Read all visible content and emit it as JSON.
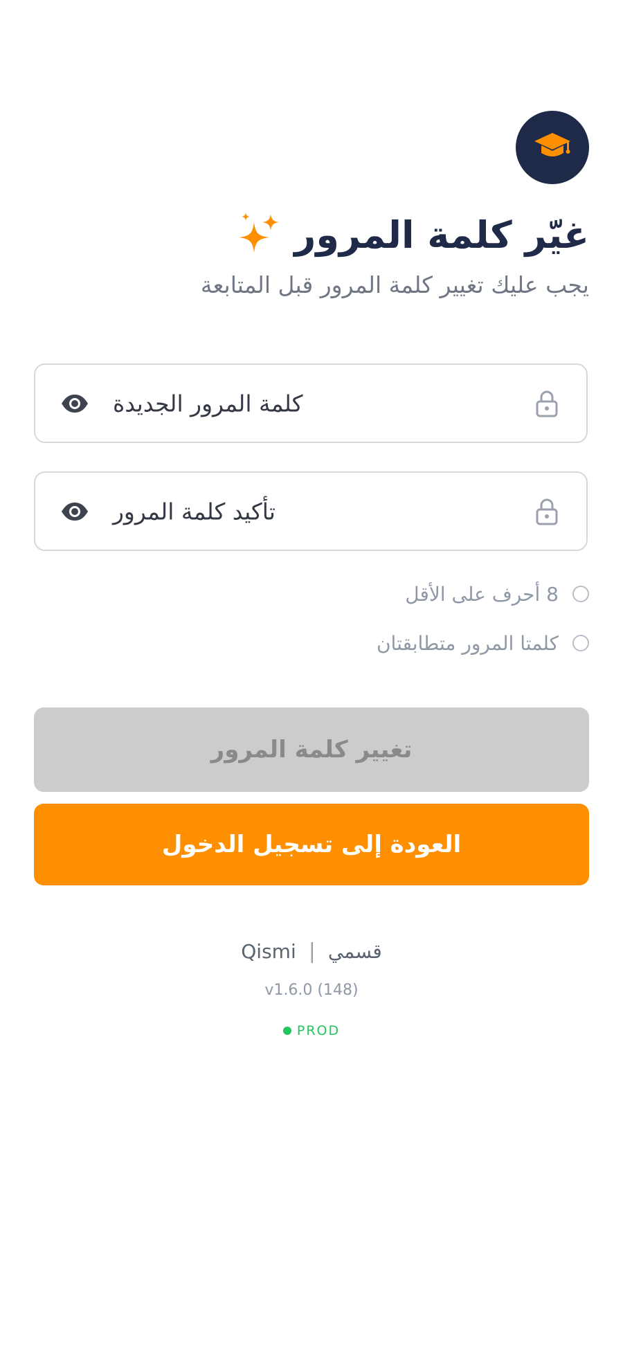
{
  "app": {
    "logo_icon": "graduation-cap-icon",
    "logo_bg": "#1e2a47",
    "accent": "#fe8f00"
  },
  "header": {
    "title": "غيّر كلمة المرور",
    "title_icon": "sparkles-icon",
    "subtitle": "يجب عليك تغيير كلمة المرور قبل المتابعة"
  },
  "form": {
    "new_password": {
      "placeholder": "كلمة المرور الجديدة",
      "value": "",
      "lead_icon": "lock-icon",
      "toggle_icon": "eye-icon"
    },
    "confirm_password": {
      "placeholder": "تأكيد كلمة المرور",
      "value": "",
      "lead_icon": "lock-icon",
      "toggle_icon": "eye-icon"
    },
    "requirements": [
      {
        "label": "8 أحرف على الأقل",
        "met": false
      },
      {
        "label": "كلمتا المرور متطابقتان",
        "met": false
      }
    ]
  },
  "actions": {
    "change_password_label": "تغيير كلمة المرور",
    "change_password_enabled": false,
    "back_to_login_label": "العودة إلى تسجيل الدخول"
  },
  "footer": {
    "brand_latin": "Qismi",
    "separator": "|",
    "brand_arabic": "قسمي",
    "version": "v1.6.0 (148)",
    "environment": "PROD",
    "environment_color": "#22c55e"
  }
}
